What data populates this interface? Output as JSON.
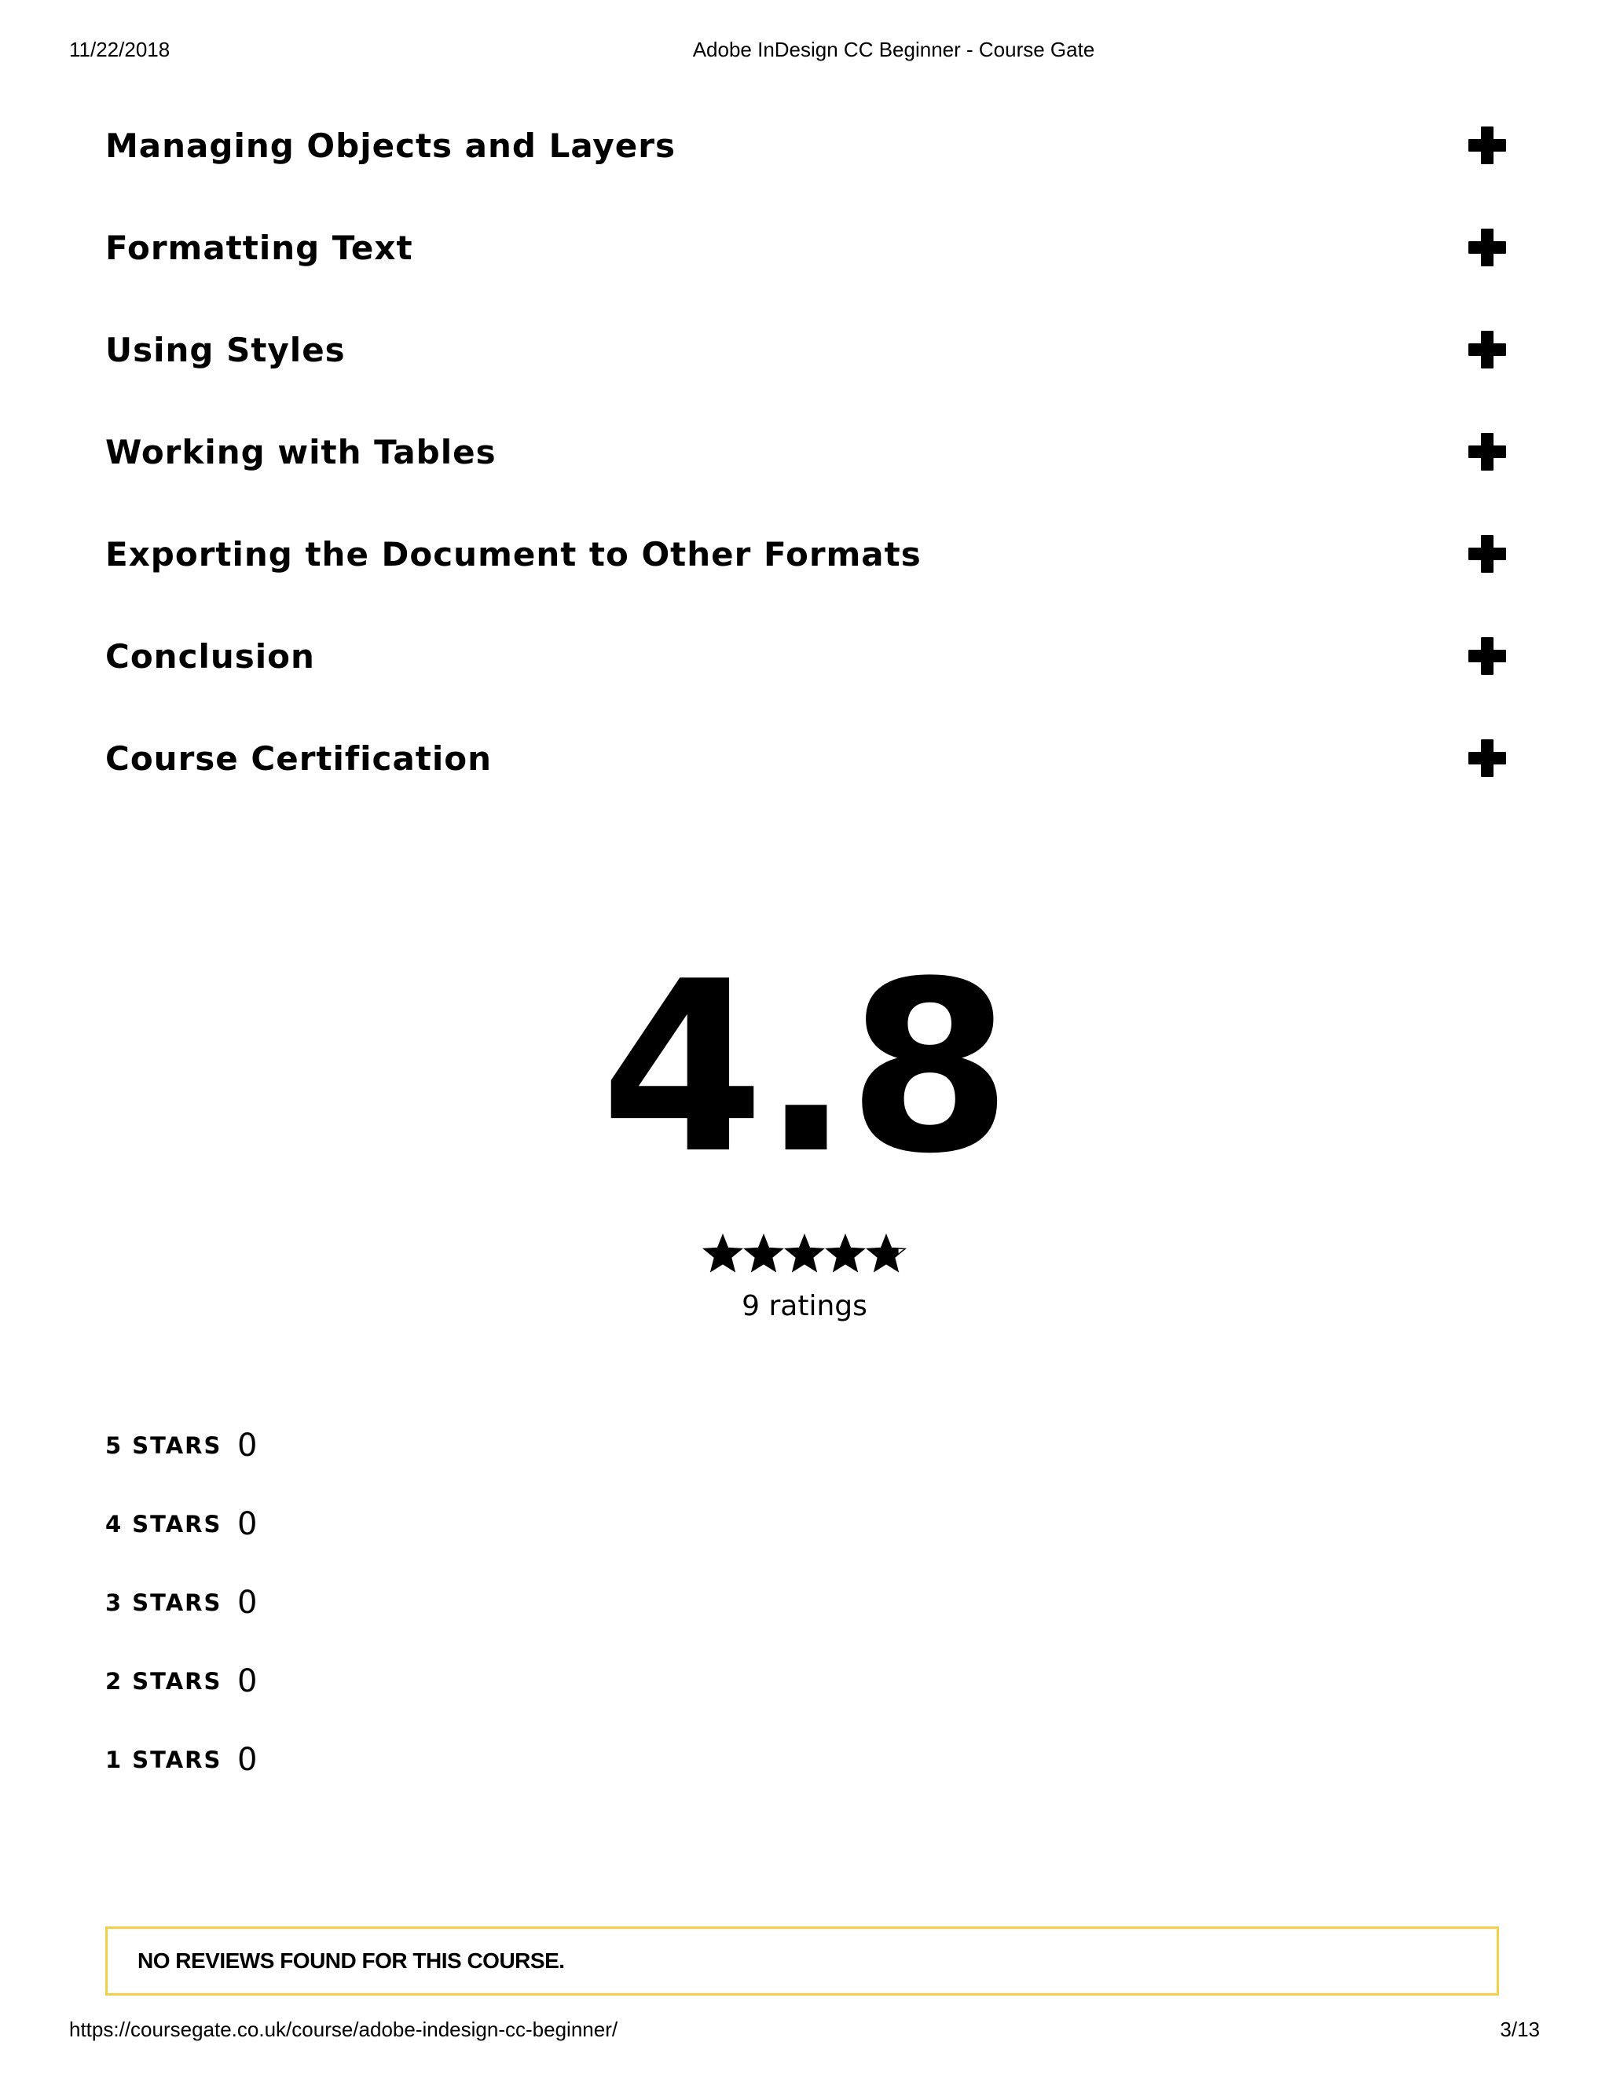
{
  "print_header": {
    "date": "11/22/2018",
    "title": "Adobe InDesign CC Beginner - Course Gate"
  },
  "curriculum": {
    "sections": [
      {
        "title": "Managing Objects and Layers",
        "icon": "plus-icon"
      },
      {
        "title": "Formatting Text",
        "icon": "plus-icon"
      },
      {
        "title": "Using Styles",
        "icon": "plus-icon"
      },
      {
        "title": "Working with Tables",
        "icon": "plus-icon"
      },
      {
        "title": "Exporting the Document to Other Formats",
        "icon": "plus-icon"
      },
      {
        "title": "Conclusion",
        "icon": "plus-icon"
      },
      {
        "title": "Course Certification",
        "icon": "plus-icon"
      }
    ]
  },
  "rating": {
    "average": "4.8",
    "stars_filled": 4.8,
    "stars_total": 5,
    "count_label": "9 ratings"
  },
  "breakdown": [
    {
      "label": "5 STARS",
      "count": "0"
    },
    {
      "label": "4 STARS",
      "count": "0"
    },
    {
      "label": "3 STARS",
      "count": "0"
    },
    {
      "label": "2 STARS",
      "count": "0"
    },
    {
      "label": "1 STARS",
      "count": "0"
    }
  ],
  "reviews": {
    "empty_message": "NO REVIEWS FOUND FOR THIS COURSE.",
    "border_color": "#f0d24a"
  },
  "print_footer": {
    "url": "https://coursegate.co.uk/course/adobe-indesign-cc-beginner/",
    "page": "3/13"
  }
}
